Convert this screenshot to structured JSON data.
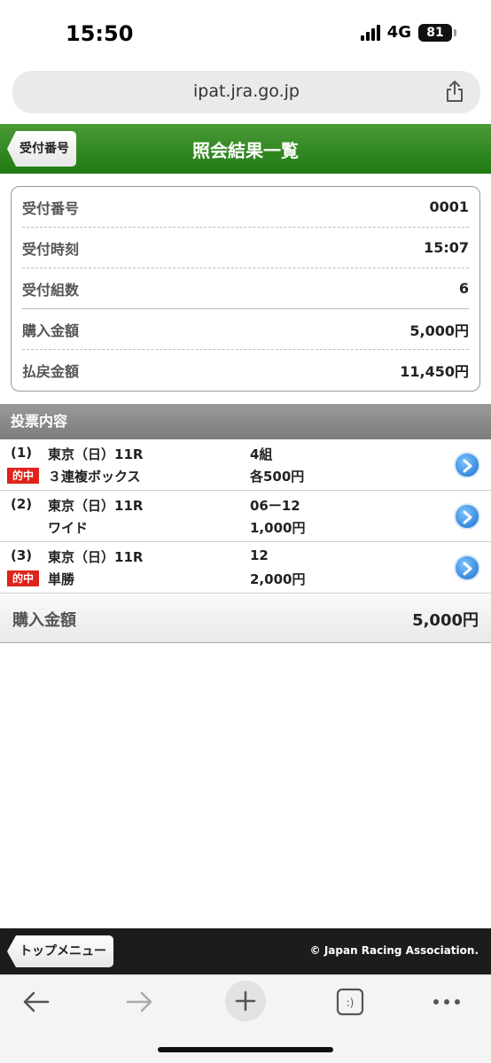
{
  "status_bar": {
    "time": "15:50",
    "network": "4G",
    "battery": "81"
  },
  "browser": {
    "url": "ipat.jra.go.jp"
  },
  "header": {
    "back_label": "受付番号",
    "title": "照会結果一覧"
  },
  "summary": {
    "rows": [
      {
        "label": "受付番号",
        "value": "0001"
      },
      {
        "label": "受付時刻",
        "value": "15:07"
      },
      {
        "label": "受付組数",
        "value": "6"
      },
      {
        "label": "購入金額",
        "value": "5,000円"
      },
      {
        "label": "払戻金額",
        "value": "11,450円"
      }
    ]
  },
  "section": {
    "title": "投票内容"
  },
  "bets": [
    {
      "num": "(1)",
      "hit": "的中",
      "venue": "東京（日）11R",
      "type": "３連複ボックス",
      "combo": "4組",
      "amount": "各500円"
    },
    {
      "num": "(2)",
      "hit": "",
      "venue": "東京（日）11R",
      "type": "ワイド",
      "combo": "06ー12",
      "amount": "1,000円"
    },
    {
      "num": "(3)",
      "hit": "的中",
      "venue": "東京（日）11R",
      "type": "単勝",
      "combo": "12",
      "amount": "2,000円"
    }
  ],
  "total": {
    "label": "購入金額",
    "value": "5,000円"
  },
  "footer": {
    "menu_label": "トップメニュー",
    "copyright": "© Japan Racing Association."
  },
  "colors": {
    "header_green": "#1f7a12",
    "hit_red": "#e0231a",
    "arrow_blue": "#1a6fd0"
  }
}
